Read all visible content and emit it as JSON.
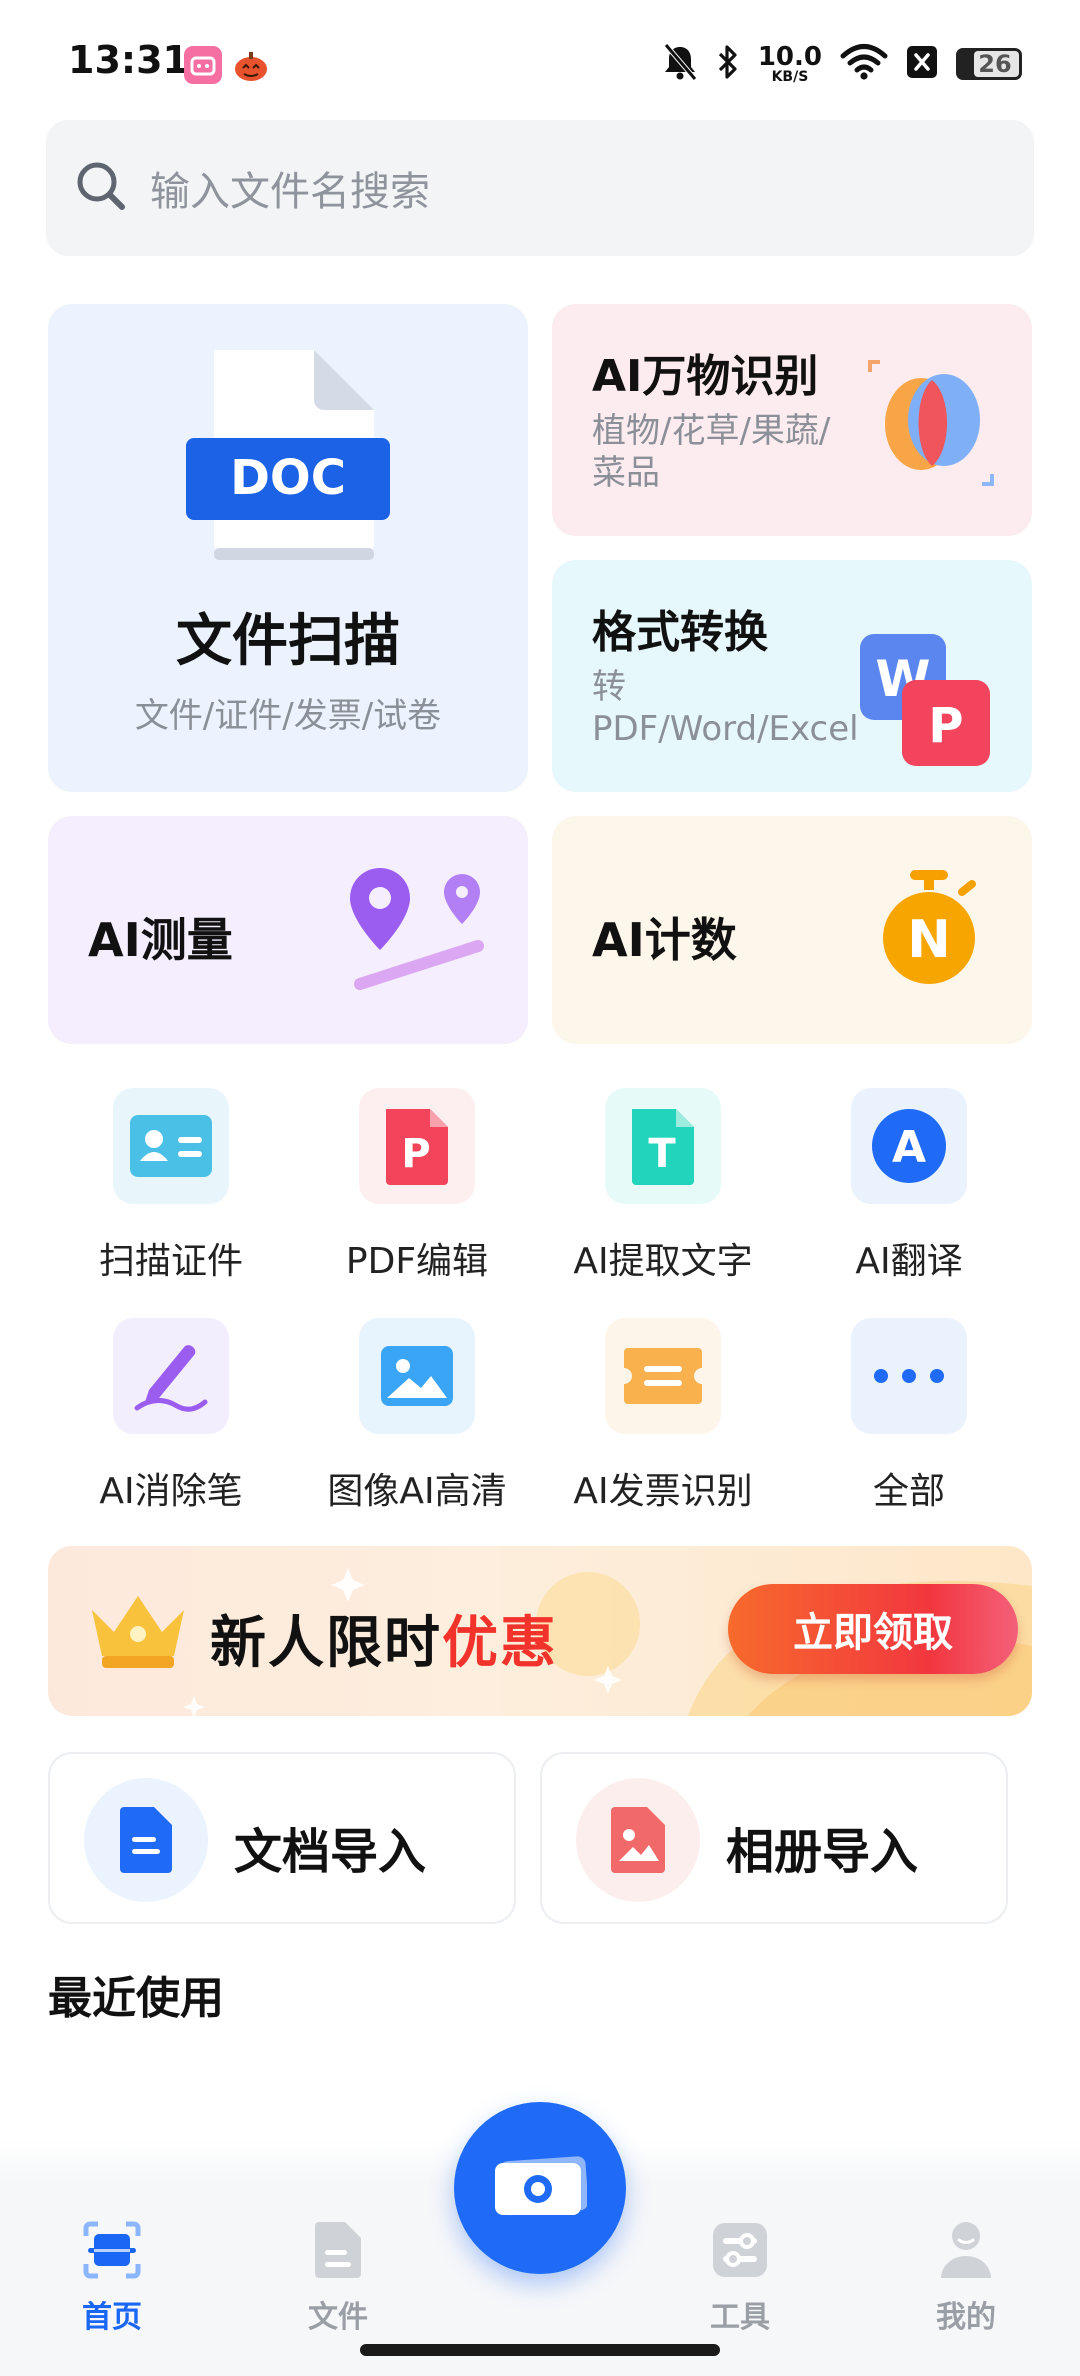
{
  "status_bar": {
    "time": "13:31",
    "net_speed_value": "10.0",
    "net_speed_unit": "KB/S",
    "battery_level": "26",
    "icons": [
      "bilibili-app-icon",
      "pumpkin-app-icon",
      "mute-bell-icon",
      "bluetooth-icon",
      "wifi-icon",
      "close-box-icon",
      "battery-icon"
    ]
  },
  "search": {
    "placeholder": "输入文件名搜索"
  },
  "cards": {
    "scan": {
      "title": "文件扫描",
      "subtitle": "文件/证件/发票/试卷",
      "doc_badge": "DOC"
    },
    "ai_recognize": {
      "title": "AI万物识别",
      "subtitle": "植物/花草/果蔬/菜品"
    },
    "convert": {
      "title": "格式转换",
      "subtitle": "转PDF/Word/Excel",
      "badge_w": "W",
      "badge_p": "P"
    },
    "measure": {
      "title": "AI测量"
    },
    "count": {
      "title": "AI计数",
      "badge": "N"
    }
  },
  "tools": [
    {
      "label": "扫描证件",
      "icon": "id-card-icon"
    },
    {
      "label": "PDF编辑",
      "icon": "pdf-icon"
    },
    {
      "label": "AI提取文字",
      "icon": "text-extract-icon"
    },
    {
      "label": "AI翻译",
      "icon": "translate-icon"
    },
    {
      "label": "AI消除笔",
      "icon": "eraser-pen-icon"
    },
    {
      "label": "图像AI高清",
      "icon": "image-enhance-icon"
    },
    {
      "label": "AI发票识别",
      "icon": "invoice-icon"
    },
    {
      "label": "全部",
      "icon": "more-icon"
    }
  ],
  "tool_glyphs": {
    "pdf": "P",
    "text": "T",
    "translate": "A"
  },
  "promo": {
    "text_main": "新人限时",
    "text_highlight": "优惠",
    "button": "立即领取"
  },
  "imports": {
    "document": "文档导入",
    "album": "相册导入"
  },
  "recent": {
    "title": "最近使用"
  },
  "nav": {
    "home": "首页",
    "files": "文件",
    "tools": "工具",
    "mine": "我的",
    "active": "home"
  },
  "colors": {
    "accent": "#1f6bf7",
    "promo_highlight": "#f2332c"
  }
}
